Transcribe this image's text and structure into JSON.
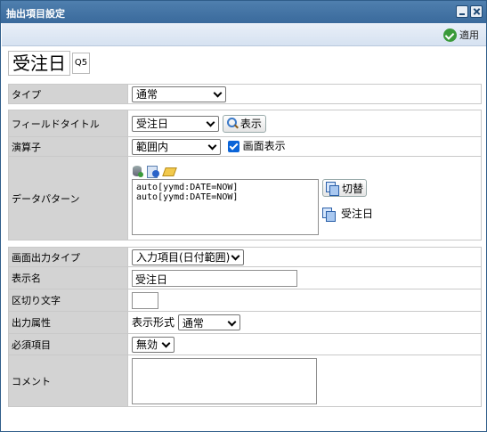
{
  "window": {
    "title": "抽出項目設定"
  },
  "toolbar": {
    "apply_label": "適用"
  },
  "heading": {
    "title": "受注日",
    "badge": "Q5"
  },
  "type_row": {
    "label": "タイプ",
    "value": "通常"
  },
  "field_title_row": {
    "label": "フィールドタイトル",
    "value": "受注日",
    "show_button": "表示"
  },
  "operator_row": {
    "label": "演算子",
    "value": "範囲内",
    "screen_display_label": "画面表示"
  },
  "data_pattern_row": {
    "label": "データパターン",
    "text_lines": [
      "auto[yymd:DATE=NOW]",
      "auto[yymd:DATE=NOW]"
    ],
    "switch_button": "切替",
    "linked_field": "受注日"
  },
  "output_type_row": {
    "label": "画面出力タイプ",
    "value": "入力項目(日付範囲)"
  },
  "display_name_row": {
    "label": "表示名",
    "value": "受注日"
  },
  "delimiter_row": {
    "label": "区切り文字",
    "value": ""
  },
  "output_attr_row": {
    "label": "出力属性",
    "format_label": "表示形式",
    "format_value": "通常"
  },
  "required_row": {
    "label": "必須項目",
    "value": "無効"
  },
  "comment_row": {
    "label": "コメント",
    "value": ""
  }
}
